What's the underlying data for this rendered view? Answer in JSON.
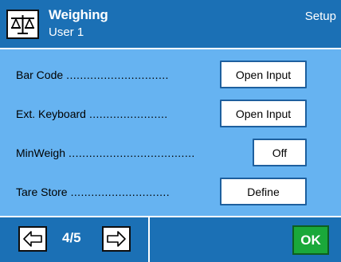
{
  "header": {
    "title": "Weighing",
    "subtitle": "User 1",
    "mode": "Setup",
    "app_icon": "balance-scale-icon"
  },
  "settings": [
    {
      "label": "Bar Code",
      "value": "Open Input"
    },
    {
      "label": "Ext. Keyboard",
      "value": "Open Input"
    },
    {
      "label": "MinWeigh",
      "value": "Off"
    },
    {
      "label": "Tare Store",
      "value": "Define"
    }
  ],
  "footer": {
    "prev_icon": "arrow-left-icon",
    "next_icon": "arrow-right-icon",
    "page_indicator": "4/5",
    "ok_label": "OK"
  },
  "colors": {
    "header_bg": "#1b70b5",
    "panel_bg": "#66b3f1",
    "ok_bg": "#1aa83a"
  }
}
